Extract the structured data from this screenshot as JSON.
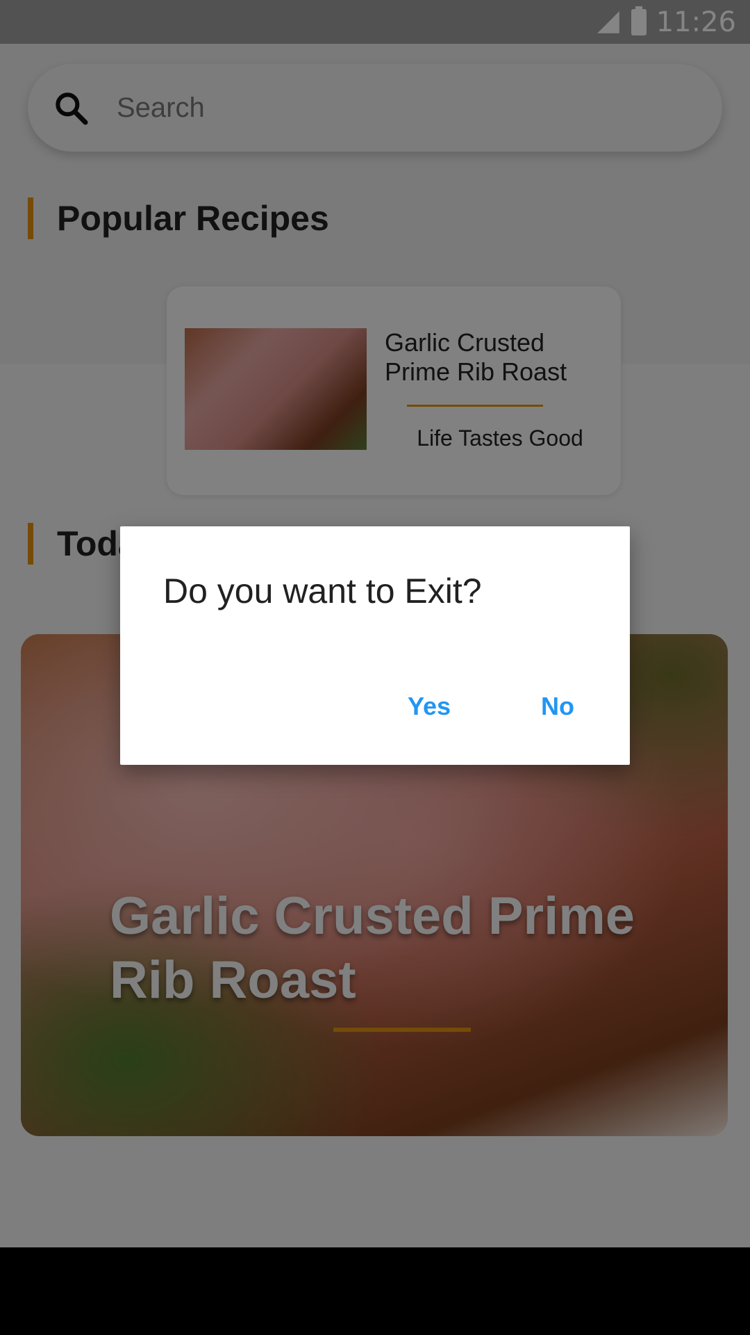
{
  "status_bar": {
    "time": "11:26"
  },
  "search": {
    "placeholder": "Search"
  },
  "sections": {
    "popular_title": "Popular Recipes",
    "today_title_visible": "Toda"
  },
  "popular_card": {
    "title": "Garlic Crusted Prime Rib Roast",
    "subtitle": "Life Tastes Good"
  },
  "today_card": {
    "title": "Garlic Crusted Prime Rib Roast"
  },
  "dialog": {
    "title": "Do you want to Exit?",
    "yes_label": "Yes",
    "no_label": "No"
  },
  "colors": {
    "accent": "#e0900f",
    "button_text": "#2196f3"
  }
}
